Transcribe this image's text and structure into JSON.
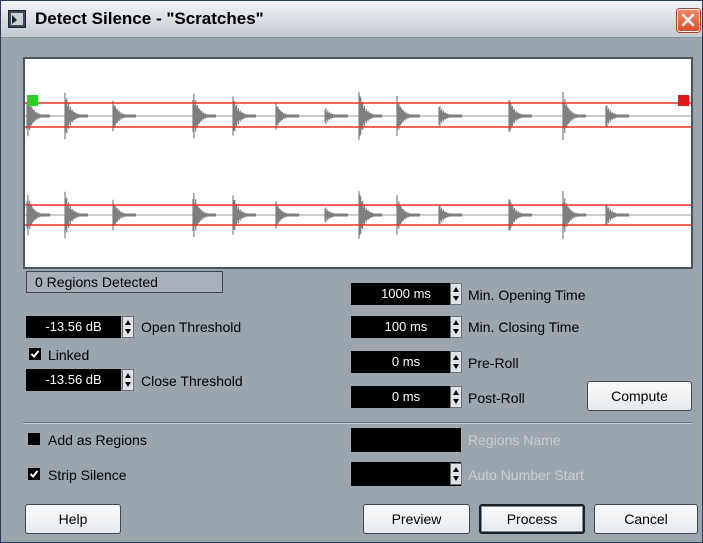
{
  "window": {
    "title": "Detect Silence - \"Scratches\""
  },
  "waveform": {
    "colors": {
      "wave": "#7f7f7f",
      "threshold": "#e8322b",
      "center": "#9a9a9a",
      "start_marker": "#22d322",
      "end_marker": "#e01818"
    }
  },
  "status": {
    "regions_detected": "0  Regions Detected"
  },
  "left": {
    "open_threshold": {
      "value": "-13.56 dB",
      "label": "Open Threshold"
    },
    "linked": {
      "label": "Linked",
      "checked": true
    },
    "close_threshold": {
      "value": "-13.56 dB",
      "label": "Close Threshold"
    }
  },
  "right": {
    "min_opening_time": {
      "value": "1000 ms",
      "label": "Min. Opening Time"
    },
    "min_closing_time": {
      "value": "100 ms",
      "label": "Min. Closing Time"
    },
    "pre_roll": {
      "value": "0 ms",
      "label": "Pre-Roll"
    },
    "post_roll": {
      "value": "0 ms",
      "label": "Post-Roll"
    },
    "compute_label": "Compute"
  },
  "options": {
    "add_as_regions": {
      "label": "Add as Regions",
      "checked": false
    },
    "strip_silence": {
      "label": "Strip Silence",
      "checked": true
    },
    "regions_name": {
      "value": "",
      "label": "Regions Name"
    },
    "auto_number_start": {
      "value": "",
      "label": "Auto Number Start"
    }
  },
  "buttons": {
    "help": "Help",
    "preview": "Preview",
    "process": "Process",
    "cancel": "Cancel"
  }
}
